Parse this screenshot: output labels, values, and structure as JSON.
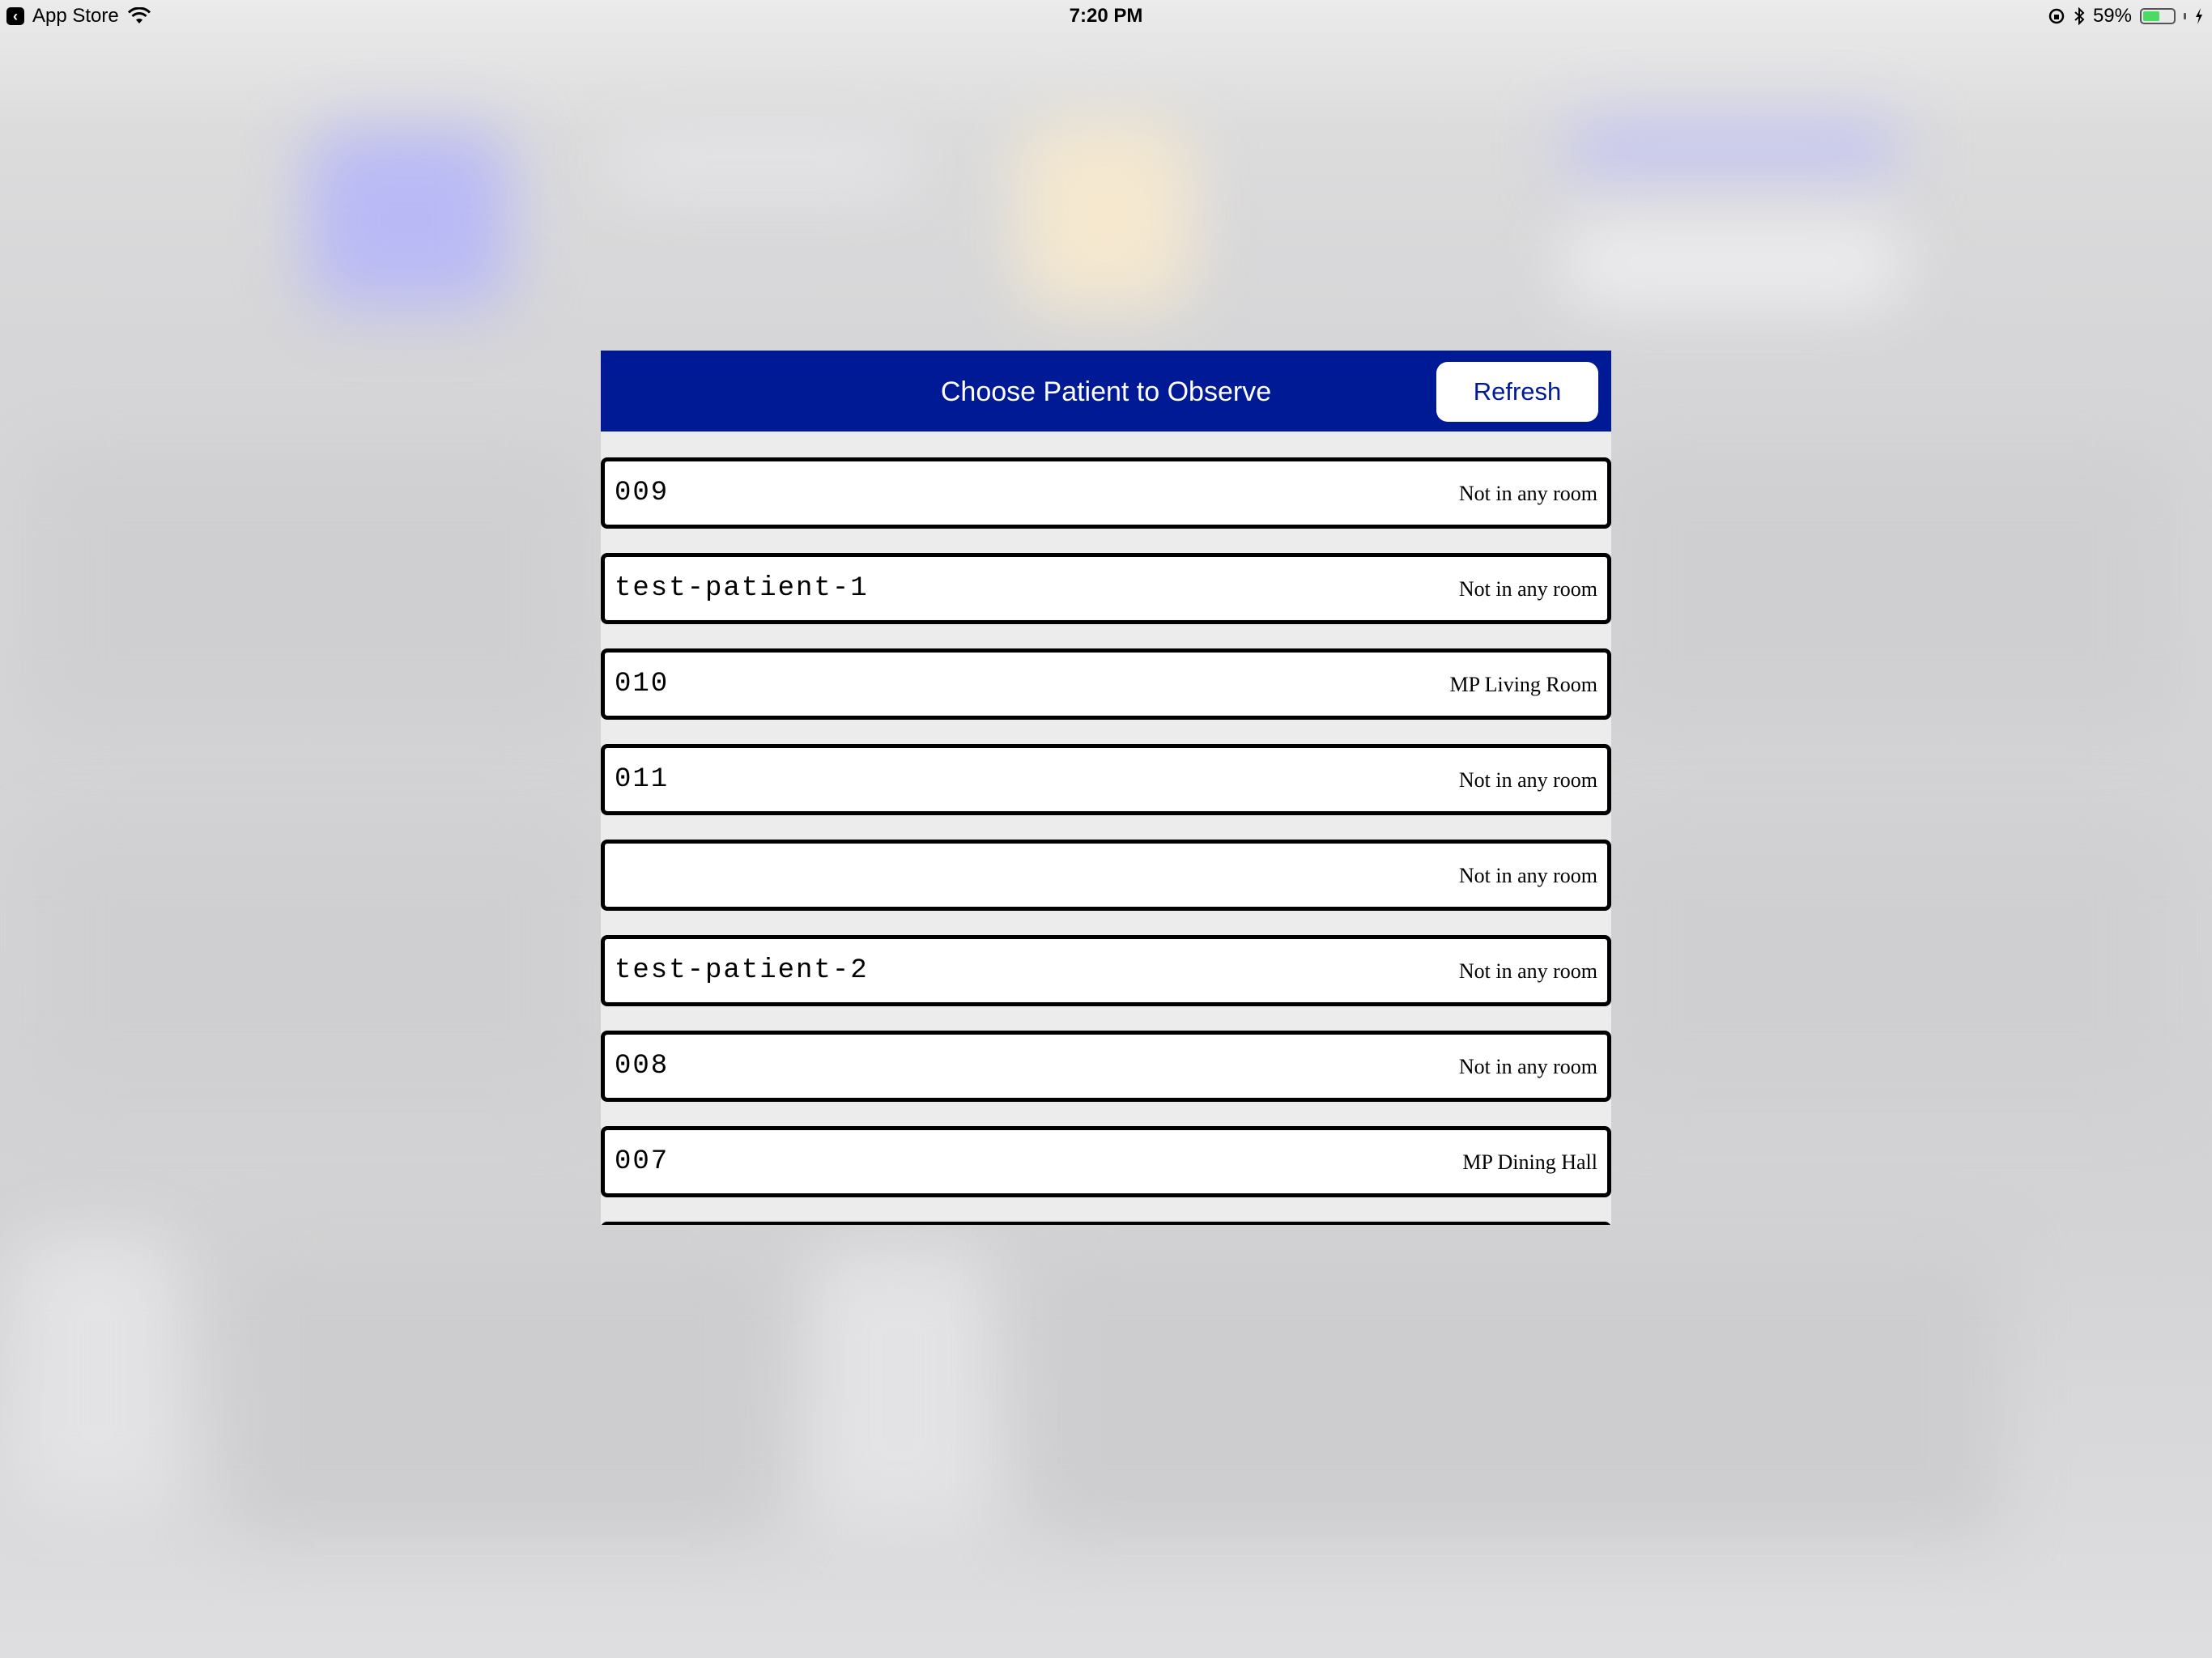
{
  "status_bar": {
    "back_app": "App Store",
    "time": "7:20 PM",
    "battery": "59%",
    "battery_level": 0.59,
    "icons": [
      "back-arrow-icon",
      "wifi-icon",
      "orientation-lock-icon",
      "bluetooth-icon",
      "battery-icon",
      "charging-bolt-icon"
    ]
  },
  "modal": {
    "title": "Choose Patient to Observe",
    "refresh_label": "Refresh",
    "header_color": "#001a95"
  },
  "patients": [
    {
      "id": "009",
      "room": "Not in any room"
    },
    {
      "id": "test-patient-1",
      "room": "Not in any room"
    },
    {
      "id": "010",
      "room": "MP Living Room"
    },
    {
      "id": "011",
      "room": "Not in any room"
    },
    {
      "id": "",
      "room": "Not in any room"
    },
    {
      "id": "test-patient-2",
      "room": "Not in any room"
    },
    {
      "id": "008",
      "room": "Not in any room"
    },
    {
      "id": "007",
      "room": "MP Dining Hall"
    }
  ]
}
